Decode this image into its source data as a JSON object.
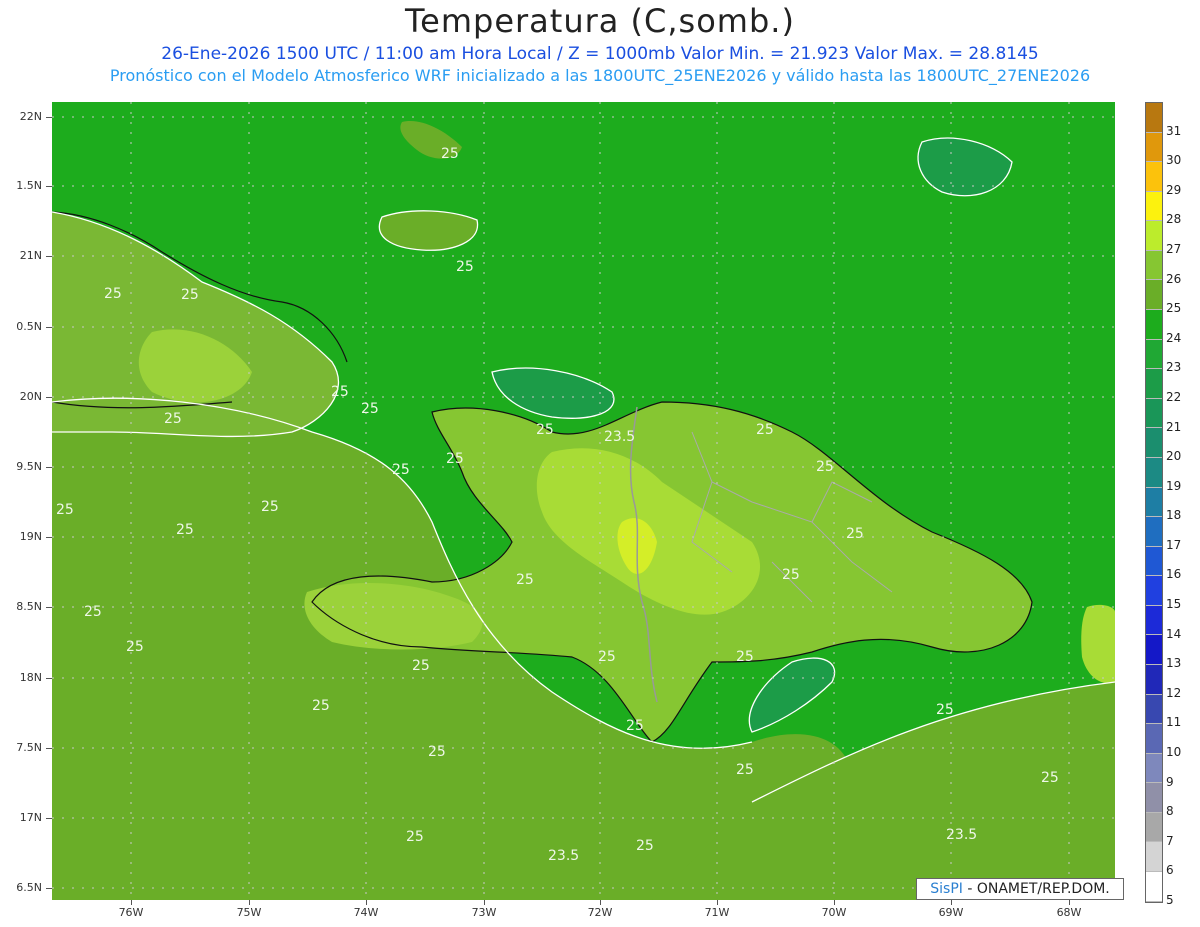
{
  "header": {
    "title": "Temperatura (C,somb.)",
    "line1": "26-Ene-2026 1500 UTC / 11:00 am Hora Local / Z = 1000mb    Valor Min. = 21.923  Valor Max. = 28.8145",
    "line2": "Pronóstico con el Modelo Atmosferico WRF inicializado a las 1800UTC_25ENE2026 y válido hasta las  1800UTC_27ENE2026"
  },
  "axes": {
    "lat_labels": [
      "22N",
      "1.5N",
      "21N",
      "0.5N",
      "20N",
      "9.5N",
      "19N",
      "8.5N",
      "18N",
      "7.5N",
      "17N",
      "6.5N"
    ],
    "lon_labels": [
      "76W",
      "75W",
      "74W",
      "73W",
      "72W",
      "71W",
      "70W",
      "69W",
      "68W"
    ]
  },
  "colorbar": {
    "labels": [
      "31",
      "30",
      "29",
      "28",
      "27",
      "26",
      "25",
      "24",
      "23",
      "22",
      "21",
      "20",
      "19",
      "18",
      "17",
      "16",
      "15",
      "14",
      "13",
      "12",
      "11",
      "10",
      "9",
      "8",
      "7",
      "6",
      "5"
    ],
    "colors": [
      "#b87810",
      "#e0980c",
      "#fcc20c",
      "#fcf20e",
      "#bcec2c",
      "#86c632",
      "#6aae28",
      "#1dac1d",
      "#20a834",
      "#1c9c48",
      "#1a9658",
      "#1b8e6e",
      "#1c8a84",
      "#1e7ea4",
      "#1f6ec0",
      "#1f58d4",
      "#2040e0",
      "#1c2ad8",
      "#1418c8",
      "#2028b8",
      "#3848b0",
      "#5a68b4",
      "#7e88bc",
      "#9090a8",
      "#a8a8a8",
      "#d4d4d4",
      "#ffffff"
    ]
  },
  "credit": {
    "brand": "SisPI",
    "text": "- ONAMET/REP.DOM."
  },
  "map": {
    "contour_labels": [
      "25",
      "25",
      "25",
      "25",
      "25",
      "25",
      "25",
      "25",
      "25",
      "25",
      "25",
      "25",
      "25",
      "25",
      "25",
      "25",
      "25",
      "25",
      "25",
      "25",
      "25",
      "25",
      "25",
      "25",
      "25",
      "25",
      "25",
      "25",
      "25",
      "25",
      "25",
      "23.5",
      "23.5",
      "23.5"
    ]
  }
}
